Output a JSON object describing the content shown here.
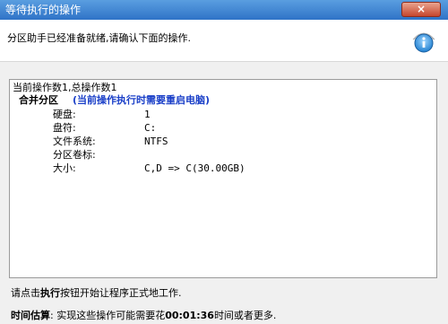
{
  "window": {
    "title": "等待执行的操作",
    "close_label": "×"
  },
  "header": {
    "text": "分区助手已经准备就绪,请确认下面的操作."
  },
  "operations": {
    "summary": "当前操作数1,总操作数1",
    "operation_name": "合并分区",
    "operation_hint": "(当前操作执行时需要重启电脑)",
    "details": [
      {
        "label": "硬盘:",
        "value": "1"
      },
      {
        "label": "盘符:",
        "value": "C:"
      },
      {
        "label": "文件系统:",
        "value": "NTFS"
      },
      {
        "label": "分区卷标:",
        "value": ""
      },
      {
        "label": "大小:",
        "value": "C,D => C(30.00GB)"
      }
    ]
  },
  "note": {
    "prefix": "请点击",
    "action": "执行",
    "suffix": "按钮开始让程序正式地工作."
  },
  "estimate": {
    "label": "时间估算",
    "prefix": ": 实现这些操作可能需要花",
    "time": "00:01:36",
    "suffix": "时间或者更多."
  },
  "colors": {
    "titlebar": "#2f73c7",
    "hint": "#1a3fc8",
    "close": "#c6462d"
  }
}
